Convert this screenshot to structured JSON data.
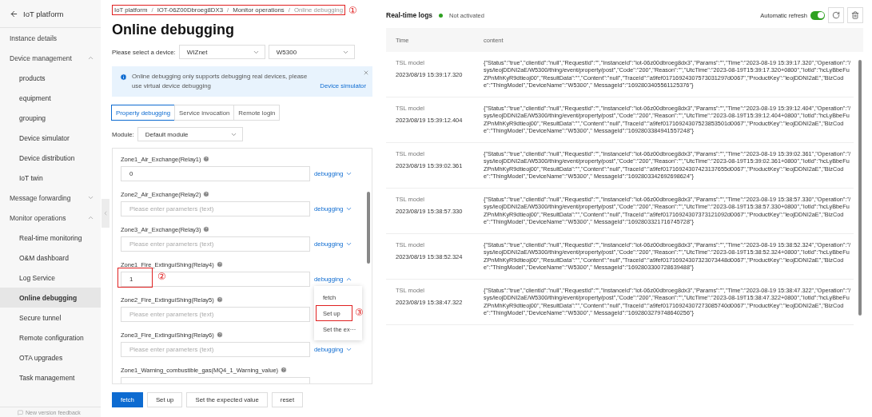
{
  "sidebar": {
    "title": "IoT platform",
    "items": [
      {
        "label": "Instance details",
        "selected": false
      },
      {
        "label": "Device management",
        "expanded": true,
        "selected": false,
        "children": [
          {
            "label": "products",
            "selected": false
          },
          {
            "label": "equipment",
            "selected": false
          },
          {
            "label": "grouping",
            "selected": false
          },
          {
            "label": "Device simulator",
            "selected": false
          },
          {
            "label": "Device distribution",
            "selected": false
          },
          {
            "label": "IoT twin",
            "selected": false
          }
        ]
      },
      {
        "label": "Message forwarding",
        "expanded": false,
        "selected": false
      },
      {
        "label": "Monitor operations",
        "expanded": true,
        "selected": false,
        "children": [
          {
            "label": "Real-time monitoring",
            "selected": false
          },
          {
            "label": "O&M dashboard",
            "selected": false
          },
          {
            "label": "Log Service",
            "selected": false
          },
          {
            "label": "Online debugging",
            "selected": true
          },
          {
            "label": "Secure tunnel",
            "selected": false
          },
          {
            "label": "Remote configuration",
            "selected": false
          },
          {
            "label": "OTA upgrades",
            "selected": false
          },
          {
            "label": "Task management",
            "selected": false
          }
        ]
      }
    ],
    "feedback": "New version feedback"
  },
  "breadcrumb": {
    "items": [
      "IoT platform",
      "IOT-06Z00Dbroeg8DX3",
      "Monitor operations",
      "Online debugging"
    ],
    "highlighted": true,
    "marker": "①",
    "separator": "/"
  },
  "page_title": "Online debugging",
  "device_select": {
    "label": "Please select a device:",
    "values": [
      "WIZnet",
      "W5300"
    ]
  },
  "notice": {
    "text": "Online debugging only supports debugging real devices, please use virtual device debugging",
    "link": "Device simulator"
  },
  "tabs": [
    {
      "label": "Property debugging",
      "selected": true
    },
    {
      "label": "Service invocation",
      "selected": false
    },
    {
      "label": "Remote login",
      "selected": false
    }
  ],
  "module": {
    "label": "Module:",
    "value": "Default module"
  },
  "fields": [
    {
      "label": "Zone1_Air_Exchange(Relay1)",
      "value": "0",
      "action": "debugging",
      "expanded": false,
      "highlighted": false
    },
    {
      "label": "Zone2_Air_Exchange(Relay2)",
      "placeholder": "Please enter parameters (text)",
      "action": "debugging",
      "expanded": false,
      "highlighted": false
    },
    {
      "label": "Zone3_Air_Exchange(Relay3)",
      "placeholder": "Please enter parameters (text)",
      "action": "debugging",
      "expanded": false,
      "highlighted": false
    },
    {
      "label": "Zone1_Fire_ExtinguiShing(Relay4)",
      "value": "1",
      "action": "debugging",
      "expanded": true,
      "highlighted": true,
      "marker": "②",
      "menu": [
        {
          "label": "fetch",
          "highlighted": false
        },
        {
          "label": "Set up",
          "highlighted": true,
          "marker": "③"
        },
        {
          "label": "Set the ex···",
          "highlighted": false
        }
      ]
    },
    {
      "label": "Zone2_Fire_ExtinguiShing(Relay5)",
      "placeholder": "Please enter parameters (text)",
      "highlighted": false
    },
    {
      "label": "Zone3_Fire_ExtinguiShing(Relay6)",
      "placeholder": "Please enter parameters (text)",
      "action": "debugging",
      "expanded": false,
      "highlighted": false
    },
    {
      "label": "Zone1_Warning_combustible_gas(MQ4_1_Warning_value)",
      "highlighted": false
    }
  ],
  "buttons": [
    {
      "label": "fetch",
      "primary": true
    },
    {
      "label": "Set up",
      "primary": false
    },
    {
      "label": "Set the expected value",
      "primary": false
    },
    {
      "label": "reset",
      "primary": false
    }
  ],
  "logs": {
    "title": "Real-time logs",
    "status": "Not activated",
    "auto_refresh_label": "Automatic refresh",
    "auto_refresh": true,
    "columns": [
      "Time",
      "content"
    ],
    "rows": [
      {
        "type": "TSL model",
        "time": "2023/08/19 15:39:17.320",
        "content": "{\"Status\":\"true\",\"clientId\":\"null\",\"RequestId\":\"\",\"InstanceId\":\"iot-06z00dbroeg8dx3\",\"Params\":\"\",\"Time\":\"2023-08-19 15:39:17.320\",\"Operation\":\"/sys/ieojDDNI2aE/W5300/thing/event/property/post\",\"Code\":\"200\",\"Reason\":\"\",\"UtcTime\":\"2023-08-19T15:39:17.320+0800\",\"IotId\":\"hcLyBbeFuZPnMhKyR9dtieoj00\",\"ResultData\":\"\",\"Content\":\"null\",\"TraceId\":\"a9fef01716924307573031297d0067\",\"ProductKey\":\"ieojDDNI2aE\",\"BizCode\":\"ThingModel\",\"DeviceName\":\"W5300\",\" MessageId\":\"1692803405561125376\"}"
      },
      {
        "type": "TSL model",
        "time": "2023/08/19 15:39:12.404",
        "content": "{\"Status\":\"true\",\"clientId\":\"null\",\"RequestId\":\"\",\"InstanceId\":\"iot-06z00dbroeg8dx3\",\"Params\":\"\",\"Time\":\"2023-08-19 15:39:12.404\",\"Operation\":\"/sys/ieojDDNI2aE/W5300/thing/event/property/post\",\"Code\":\"200\",\"Reason\":\"\",\"UtcTime\":\"2023-08-19T15:39:12.404+0800\",\"IotId\":\"hcLyBbeFuZPnMhKyR9dtieoj00\",\"ResultData\":\"\",\"Content\":\"null\",\"TraceId\":\"a9fef01716924307523853501d0067\",\"ProductKey\":\"ieojDDNI2aE\",\"BizCode\":\"ThingModel\",\"DeviceName\":\"W5300\",\" MessageId\":\"1692803384941557248\"}"
      },
      {
        "type": "TSL model",
        "time": "2023/08/19 15:39:02.361",
        "content": "{\"Status\":\"true\",\"clientId\":\"null\",\"RequestId\":\"\",\"InstanceId\":\"iot-06z00dbroeg8dx3\",\"Params\":\"\",\"Time\":\"2023-08-19 15:39:02.361\",\"Operation\":\"/sys/ieojDDNI2aE/W5300/thing/event/property/post\",\"Code\":\"200\",\"Reason\":\"\",\"UtcTime\":\"2023-08-19T15:39:02.361+0800\",\"IotId\":\"hcLyBbeFuZPnMhKyR9dtieoj00\",\"ResultData\":\"\",\"Content\":\"null\",\"TraceId\":\"a9fef01716924307423137655d0067\",\"ProductKey\":\"ieojDDNI2aE\",\"BizCode\":\"ThingModel\",\"DeviceName\":\"W5300\",\" MessageId\":\"1692803342692698624\"}"
      },
      {
        "type": "TSL model",
        "time": "2023/08/19 15:38:57.330",
        "content": "{\"Status\":\"true\",\"clientId\":\"null\",\"RequestId\":\"\",\"InstanceId\":\"iot-06z00dbroeg8dx3\",\"Params\":\"\",\"Time\":\"2023-08-19 15:38:57.330\",\"Operation\":\"/sys/ieojDDNI2aE/W5300/thing/event/property/post\",\"Code\":\"200\",\"Reason\":\"\",\"UtcTime\":\"2023-08-19T15:38:57.330+0800\",\"IotId\":\"hcLyBbeFuZPnMhKyR9dtieoj00\",\"ResultData\":\"\",\"Content\":\"null\",\"TraceId\":\"a9fef01716924307373121092d0067\",\"ProductKey\":\"ieojDDNI2aE\",\"BizCode\":\"ThingModel\",\"DeviceName\":\"W5300\",\" MessageId\":\"1692803321716745728\"}"
      },
      {
        "type": "TSL model",
        "time": "2023/08/19 15:38:52.324",
        "content": "{\"Status\":\"true\",\"clientId\":\"null\",\"RequestId\":\"\",\"InstanceId\":\"iot-06z00dbroeg8dx3\",\"Params\":\"\",\"Time\":\"2023-08-19 15:38:52.324\",\"Operation\":\"/sys/ieojDDNI2aE/W5300/thing/event/property/post\",\"Code\":\"200\",\"Reason\":\"\",\"UtcTime\":\"2023-08-19T15:38:52.324+0800\",\"IotId\":\"hcLyBbeFuZPnMhKyR9dtieoj00\",\"ResultData\":\"\",\"Content\":\"null\",\"TraceId\":\"a9fef01716924307323073448d0067\",\"ProductKey\":\"ieojDDNI2aE\",\"BizCode\":\"ThingModel\",\"DeviceName\":\"W5300\",\" MessageId\":\"1692803300728639488\"}"
      },
      {
        "type": "TSL model",
        "time": "2023/08/19 15:38:47.322",
        "content": "{\"Status\":\"true\",\"clientId\":\"null\",\"RequestId\":\"\",\"InstanceId\":\"iot-06z00dbroeg8dx3\",\"Params\":\"\",\"Time\":\"2023-08-19 15:38:47.322\",\"Operation\":\"/sys/ieojDDNI2aE/W5300/thing/event/property/post\",\"Code\":\"200\",\"Reason\":\"\",\"UtcTime\":\"2023-08-19T15:38:47.322+0800\",\"IotId\":\"hcLyBbeFuZPnMhKyR9dtieoj00\",\"ResultData\":\"\",\"Content\":\"null\",\"TraceId\":\"a9fef01716924307273085740d0067\",\"ProductKey\":\"ieojDDNI2aE\",\"BizCode\":\"ThingModel\",\"DeviceName\":\"W5300\",\" MessageId\":\"1692803279748640256\"}"
      }
    ]
  }
}
